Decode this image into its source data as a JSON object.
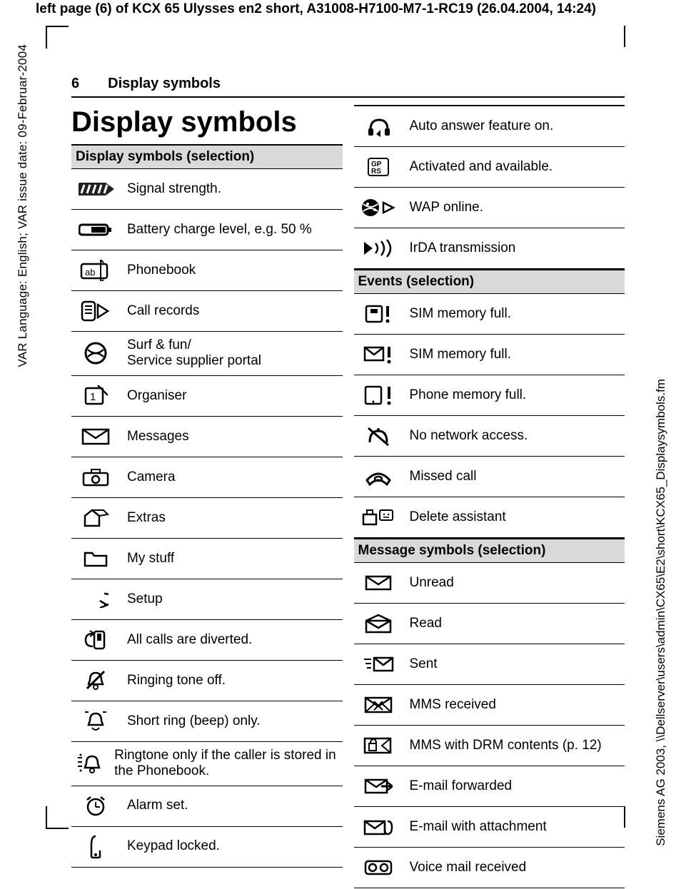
{
  "header": {
    "page_ref_bold": "left page (6)",
    "page_ref_rest": " of KCX 65 Ulysses en2 short, A31008-H7100-M7-1-RC19 (26.04.2004, 14:24)"
  },
  "margin_left_text": "VAR Language: English; VAR issue date: 09-Februar-2004",
  "margin_right_text": "Siemens AG 2003, \\\\Dellserver\\users\\admin\\CX65\\E2\\short\\KCX65_Displaysymbols.fm",
  "running_head": {
    "page_number": "6",
    "title": "Display symbols"
  },
  "title": "Display symbols",
  "sections": {
    "left": {
      "header": "Display symbols (selection)",
      "rows": [
        {
          "icon": "signal",
          "label": "Signal strength."
        },
        {
          "icon": "battery",
          "label": "Battery charge level, e.g. 50 %"
        },
        {
          "icon": "phonebook",
          "label": "Phonebook"
        },
        {
          "icon": "callrecords",
          "label": "Call records"
        },
        {
          "icon": "globe",
          "label": "Surf & fun/\nService supplier portal"
        },
        {
          "icon": "organiser",
          "label": "Organiser"
        },
        {
          "icon": "messages",
          "label": "Messages"
        },
        {
          "icon": "camera",
          "label": "Camera"
        },
        {
          "icon": "extras",
          "label": "Extras"
        },
        {
          "icon": "folder",
          "label": "My stuff"
        },
        {
          "icon": "setup",
          "label": "Setup"
        },
        {
          "icon": "divert",
          "label": "All calls are diverted."
        },
        {
          "icon": "belloff",
          "label": "Ringing tone off."
        },
        {
          "icon": "beep",
          "label": "Short ring (beep) only."
        },
        {
          "icon": "ringpb",
          "label": "Ringtone only if the caller is stored in the Phonebook."
        },
        {
          "icon": "alarm",
          "label": "Alarm set."
        },
        {
          "icon": "keylock",
          "label": "Keypad locked."
        }
      ]
    },
    "right_top": {
      "rows": [
        {
          "icon": "autoanswer",
          "label": "Auto answer feature on."
        },
        {
          "icon": "gprs",
          "label": "Activated and available."
        },
        {
          "icon": "wap",
          "label": "WAP online."
        },
        {
          "icon": "irda",
          "label": "IrDA transmission"
        }
      ]
    },
    "events": {
      "header": "Events (selection)",
      "rows": [
        {
          "icon": "simfull1",
          "label": "SIM memory full."
        },
        {
          "icon": "simfull2",
          "label": "SIM memory full."
        },
        {
          "icon": "phonefull",
          "label": "Phone memory full."
        },
        {
          "icon": "nonetwork",
          "label": "No network access."
        },
        {
          "icon": "missedcall",
          "label": "Missed call"
        },
        {
          "icon": "deleteassist",
          "label": "Delete assistant"
        }
      ]
    },
    "messages": {
      "header": "Message symbols (selection)",
      "rows": [
        {
          "icon": "unread",
          "label": "Unread"
        },
        {
          "icon": "read",
          "label": "Read"
        },
        {
          "icon": "sent",
          "label": "Sent"
        },
        {
          "icon": "mmsrec",
          "label": "MMS received"
        },
        {
          "icon": "mmsdrm",
          "label": "MMS with DRM contents (p. 12)"
        },
        {
          "icon": "emailfwd",
          "label": "E-mail forwarded"
        },
        {
          "icon": "emailatt",
          "label": "E-mail with attachment"
        },
        {
          "icon": "vmail",
          "label": "Voice mail received"
        }
      ]
    }
  }
}
